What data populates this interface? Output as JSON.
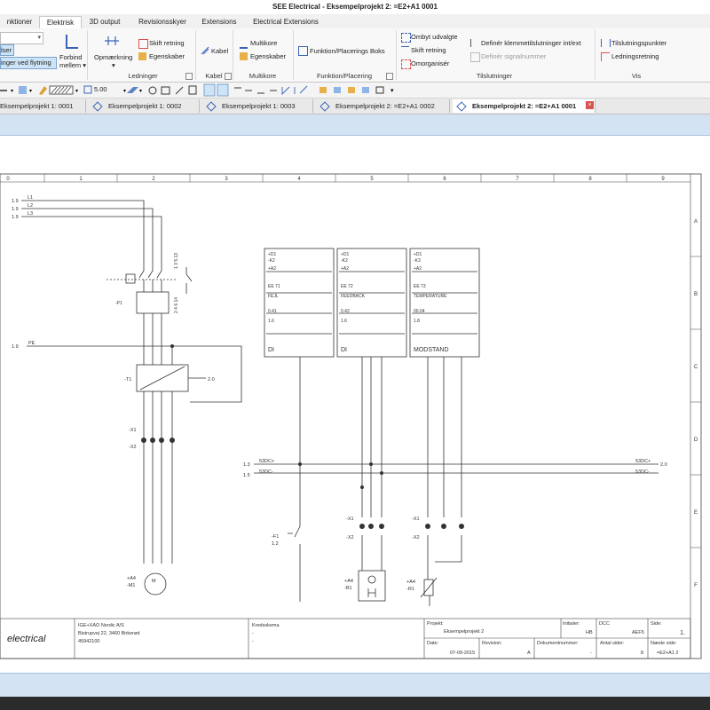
{
  "window": {
    "title": "SEE Electrical - Eksempelprojekt 2: =E2+A1 0001"
  },
  "menu_tabs": [
    {
      "label": "nktioner",
      "active": false
    },
    {
      "label": "Elektrisk",
      "active": true
    },
    {
      "label": "3D output",
      "active": false
    },
    {
      "label": "Revisionsskyer",
      "active": false
    },
    {
      "label": "Extensions",
      "active": false
    },
    {
      "label": "Electrical Extensions",
      "active": false
    }
  ],
  "ribbon": {
    "left": {
      "item1": "lser",
      "item2": "inger ved flytning",
      "connect": "Forbind",
      "between": "mellem ▾"
    },
    "ledninger": {
      "marking": "Opmærkning",
      "switch_direction": "Skift retning",
      "properties": "Egenskaber",
      "label": "Ledninger"
    },
    "kabel": {
      "cable": "Kabel",
      "label": "Kabel"
    },
    "multikore": {
      "multicore": "Multikore",
      "properties": "Egenskaber",
      "label": "Multikore"
    },
    "funktion": {
      "box": "Funktion/Placerings Boks",
      "label": "Funktion/Placering"
    },
    "tilslutninger": {
      "swap": "Ombyt udvalgte",
      "switch_direction": "Skift retning",
      "reorganize": "Omorganisér",
      "define_terminal": "Definér klemmetilslutninger int/ext",
      "define_signal": "Definér signalnummer",
      "label": "Tilslutninger"
    },
    "vis": {
      "connection_points": "Tilslutningspunkter",
      "wire_direction": "Ledningsretning",
      "label": "Vis"
    }
  },
  "toolbar": {
    "line_width": "5.00"
  },
  "doc_tabs": [
    {
      "label": "Eksempelprojekt 1: 0001",
      "active": false
    },
    {
      "label": "Eksempelprojekt 1: 0002",
      "active": false
    },
    {
      "label": "Eksempelprojekt 1: 0003",
      "active": false
    },
    {
      "label": "Eksempelprojekt 2: =E2+A1 0002",
      "active": false
    },
    {
      "label": "Eksempelprojekt 2: =E2+A1 0001",
      "active": true
    }
  ],
  "schematic": {
    "columns": [
      "0",
      "1",
      "2",
      "3",
      "4",
      "5",
      "6",
      "7",
      "8",
      "9"
    ],
    "rows": [
      "A",
      "B",
      "C",
      "D",
      "E",
      "F"
    ],
    "phases": [
      {
        "ref": "1.9",
        "name": "L1"
      },
      {
        "ref": "1.9",
        "name": "L2"
      },
      {
        "ref": "1.9",
        "name": "L3"
      }
    ],
    "pe": {
      "ref": "1.9",
      "name": "PE"
    },
    "breaker": {
      "tag": "-P1",
      "terminals": "1 3 5 13",
      "bottom": "2 4 6 14"
    },
    "converter": {
      "tag": "-T1",
      "out_ref": "2.0"
    },
    "terminal_tags": [
      "-X1",
      "-X2"
    ],
    "motor": {
      "tag1": "+A4",
      "tag2": "-M1",
      "symbol": "M",
      "pins": [
        "U1",
        "V1",
        "W1",
        "PE"
      ]
    },
    "dc_lines": [
      {
        "ref_in": "1.3",
        "name_in": "53DC+",
        "name_out": "53DC+",
        "ref_out": "2.0"
      },
      {
        "ref_in": "1.5",
        "name_in": "53DC-",
        "name_out": "53DC-",
        "ref_out": ""
      }
    ],
    "plc_boxes": [
      {
        "l1": "+D1",
        "l2": "-K2",
        "l3": "+A2",
        "ee": "EE 71",
        "desc": "FEJL",
        "addr": "0.41",
        "num": "1.6",
        "type": "DI"
      },
      {
        "l1": "+D1",
        "l2": "-K2",
        "l3": "+A2",
        "ee": "EE 72",
        "desc": "FEEDBACK",
        "addr": "0.42",
        "num": "1.6",
        "type": "DI"
      },
      {
        "l1": "+D1",
        "l2": "-K3",
        "l3": "+A2",
        "ee": "EE 73",
        "desc": "TEMPERATURE",
        "addr": "00.04",
        "num": "1.8",
        "type": "MODSTAND"
      }
    ],
    "contact_f1": {
      "tag": "-F1",
      "ref": "1.2"
    },
    "relay": {
      "tag1": "+A4",
      "tag2": "-B1"
    },
    "resistor": {
      "tag1": "+A4",
      "tag2": "-R1"
    },
    "term_groups": [
      {
        "tag1": "-X1",
        "tag2": "-X2",
        "nums": [
          "5",
          "6",
          "7"
        ]
      },
      {
        "tag1": "-X1",
        "tag2": "-X2",
        "nums": [
          "9",
          "9",
          "10"
        ]
      }
    ]
  },
  "title_block": {
    "logo": "electrical",
    "company": "IGE+XAO Nordic A/S",
    "address": "Bistrupvej 22, 3460 Birkerød",
    "phone": "45942100",
    "drawing_type": "Kredsskema",
    "dash1": "-",
    "dash2": "-",
    "project_label": "Projekt:",
    "project_value": "Eksempelprojekt 2",
    "initials_label": "Initialer:",
    "initials_value": "HB",
    "dcc_label": "DCC",
    "dcc_value": "AEF5",
    "page_label": "Side:",
    "page_value": "1.",
    "date_label": "Date:",
    "date_value": "07-09-2015",
    "revision_label": "Revision:",
    "revision_value": "A",
    "docnum_label": "Dokumentnummer:",
    "docnum_value": "-",
    "pages_label": "Antal sider:",
    "pages_value": "8",
    "next_label": "Næste side:",
    "next_value": "=E2+A1 2"
  },
  "colors": {
    "accent": "#3a63b8",
    "ribbon_bg": "#f8f8f8",
    "bluebar": "#d4e3f4",
    "close": "#d9534f"
  }
}
